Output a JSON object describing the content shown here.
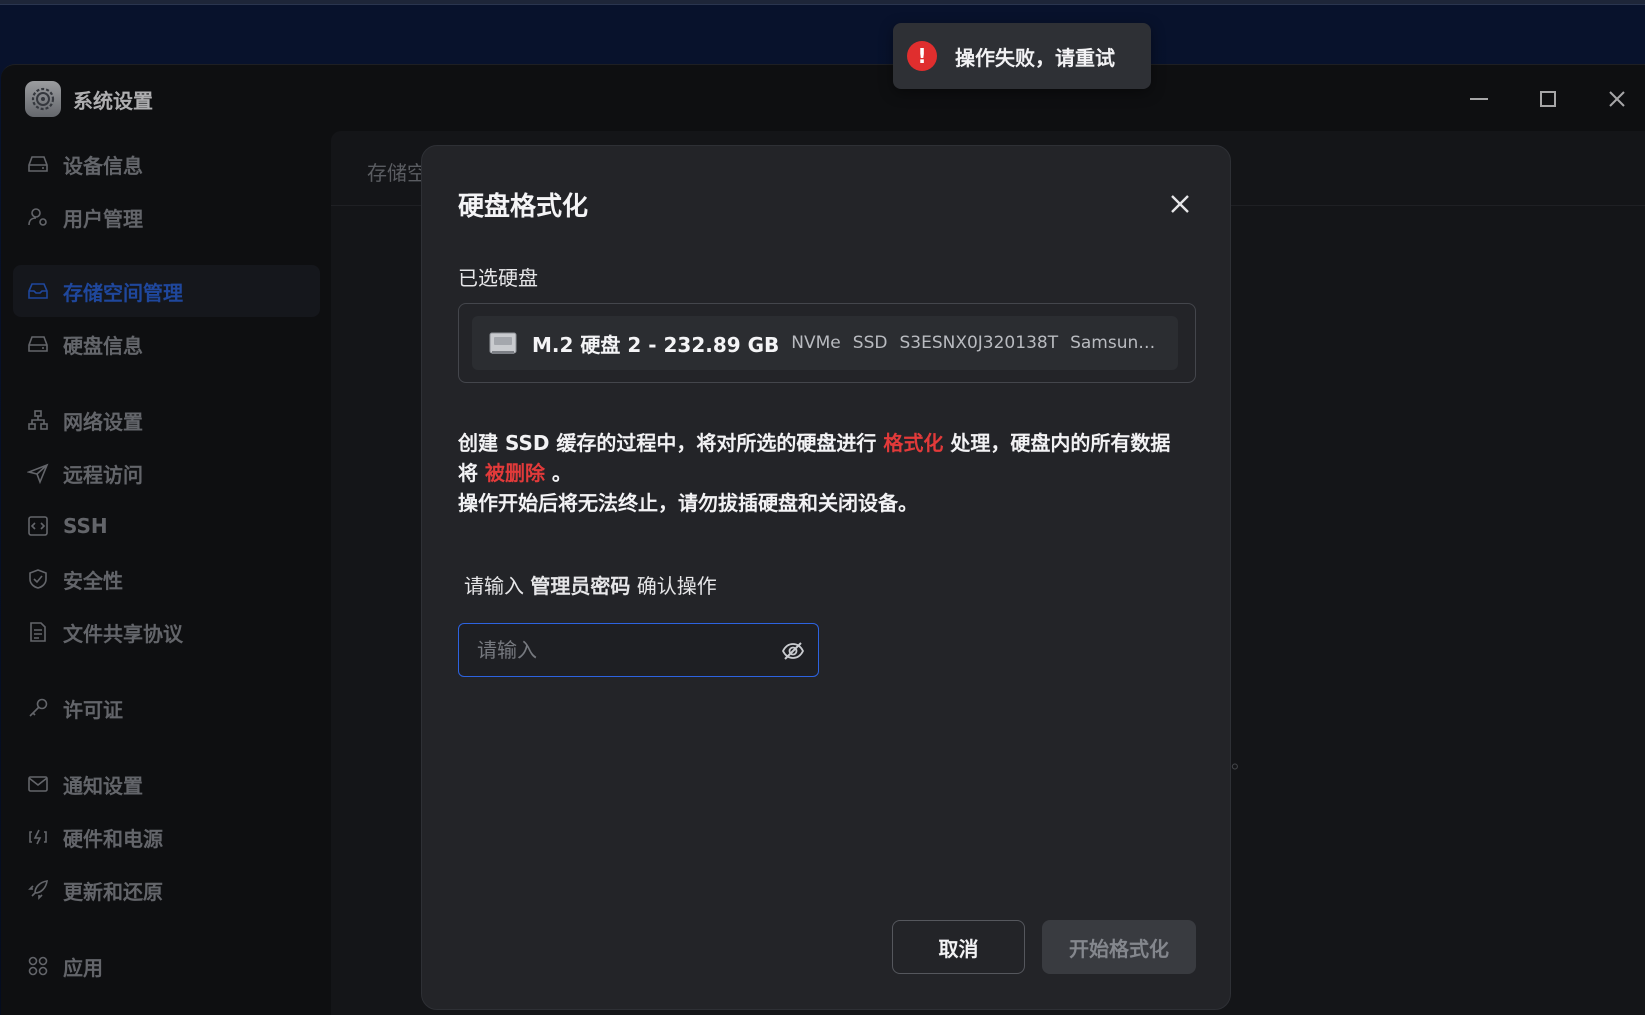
{
  "window": {
    "title": "系统设置"
  },
  "sidebar": {
    "items": [
      {
        "label": "设备信息",
        "icon": "drive-icon"
      },
      {
        "label": "用户管理",
        "icon": "user-gear-icon"
      },
      {
        "label": "存储空间管理",
        "icon": "storage-icon",
        "active": true
      },
      {
        "label": "硬盘信息",
        "icon": "drive-icon"
      },
      {
        "label": "网络设置",
        "icon": "network-icon"
      },
      {
        "label": "远程访问",
        "icon": "send-icon"
      },
      {
        "label": "SSH",
        "icon": "terminal-icon"
      },
      {
        "label": "安全性",
        "icon": "shield-icon"
      },
      {
        "label": "文件共享协议",
        "icon": "document-icon"
      },
      {
        "label": "许可证",
        "icon": "key-icon"
      },
      {
        "label": "通知设置",
        "icon": "mail-icon"
      },
      {
        "label": "硬件和电源",
        "icon": "power-icon"
      },
      {
        "label": "更新和还原",
        "icon": "rocket-icon"
      },
      {
        "label": "应用",
        "icon": "apps-icon"
      }
    ]
  },
  "content": {
    "tab_label": "存储空",
    "hint_fragment": "。"
  },
  "modal": {
    "title": "硬盘格式化",
    "selected_label": "已选硬盘",
    "disk": {
      "name": "M.2 硬盘 2 - 232.89 GB",
      "interface": "NVMe",
      "type": "SSD",
      "serial": "S3ESNX0J320138T",
      "vendor": "Samsung S..."
    },
    "warning": {
      "part1": "创建 SSD 缓存的过程中，将对所选的硬盘进行 ",
      "highlight1": "格式化",
      "part2": " 处理，硬盘内的所有数据将 ",
      "highlight2": "被删除",
      "part3": " 。",
      "line2": "操作开始后将无法终止，请勿拔插硬盘和关闭设备。"
    },
    "password": {
      "label_pre": "请输入 ",
      "label_bold": "管理员密码",
      "label_post": " 确认操作",
      "placeholder": "请输入"
    },
    "buttons": {
      "cancel": "取消",
      "start": "开始格式化"
    }
  },
  "toast": {
    "message": "操作失败，请重试",
    "color": "#e02e2e"
  },
  "colors": {
    "accent": "#2b63d9",
    "danger": "#e23a3a"
  }
}
